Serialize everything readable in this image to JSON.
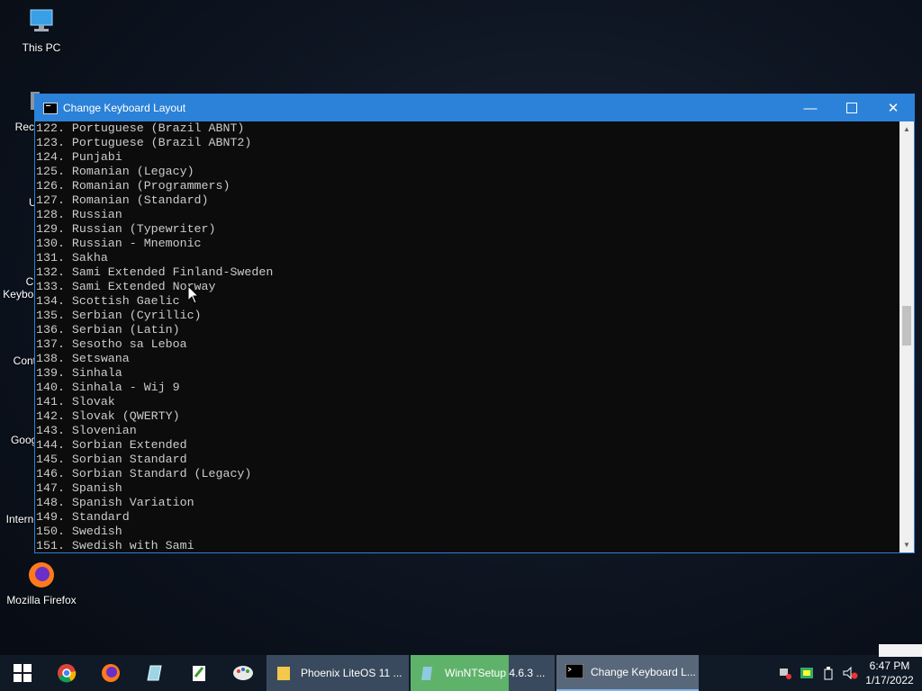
{
  "desktop": {
    "icons": [
      {
        "label": "This PC"
      },
      {
        "label": "Recy"
      },
      {
        "label": "Ut"
      },
      {
        "label": "Ch"
      },
      {
        "label": "Keyboa"
      },
      {
        "label": "Contr"
      },
      {
        "label": "Googl"
      },
      {
        "label": "Interne"
      },
      {
        "label": "Mozilla Firefox"
      }
    ]
  },
  "window": {
    "title": "Change Keyboard Layout",
    "minimize_glyph": "—",
    "close_glyph": "✕",
    "lines": [
      "122. Portuguese (Brazil ABNT)",
      "123. Portuguese (Brazil ABNT2)",
      "124. Punjabi",
      "125. Romanian (Legacy)",
      "126. Romanian (Programmers)",
      "127. Romanian (Standard)",
      "128. Russian",
      "129. Russian (Typewriter)",
      "130. Russian - Mnemonic",
      "131. Sakha",
      "132. Sami Extended Finland-Sweden",
      "133. Sami Extended Norway",
      "134. Scottish Gaelic",
      "135. Serbian (Cyrillic)",
      "136. Serbian (Latin)",
      "137. Sesotho sa Leboa",
      "138. Setswana",
      "139. Sinhala",
      "140. Sinhala - Wij 9",
      "141. Slovak",
      "142. Slovak (QWERTY)",
      "143. Slovenian",
      "144. Sorbian Extended",
      "145. Sorbian Standard",
      "146. Sorbian Standard (Legacy)",
      "147. Spanish",
      "148. Spanish Variation",
      "149. Standard",
      "150. Swedish",
      "151. Swedish with Sami"
    ]
  },
  "taskbar": {
    "pinned": [
      {
        "name": "start-button"
      },
      {
        "name": "chrome"
      },
      {
        "name": "firefox"
      },
      {
        "name": "notepad"
      },
      {
        "name": "notepadpp"
      },
      {
        "name": "paint"
      }
    ],
    "tasks": [
      {
        "label": "Phoenix LiteOS 11 ...",
        "bg": "#3a4a5e"
      },
      {
        "label": "WinNTSetup 4.6.3   ...",
        "bg": "#5fb26a"
      },
      {
        "label": "Change Keyboard L...",
        "bg": "#58677a"
      }
    ],
    "clock": {
      "time": "6:47 PM",
      "date": "1/17/2022"
    }
  },
  "colors": {
    "titlebar": "#2b82d8",
    "console_bg": "#0c0c0c",
    "console_text": "#cccccc",
    "taskbar": "#101926"
  }
}
